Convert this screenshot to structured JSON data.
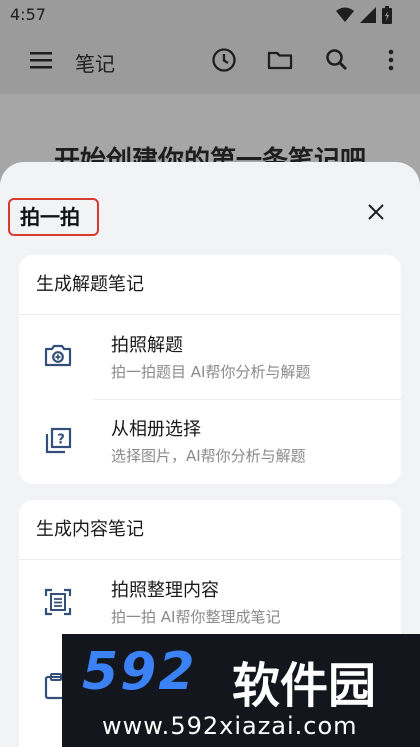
{
  "status": {
    "time": "4:57"
  },
  "appbar": {
    "title": "笔记"
  },
  "background": {
    "heading": "开始创建你的第一条笔记吧"
  },
  "sheet": {
    "title": "拍一拍",
    "sections": [
      {
        "heading": "生成解题笔记",
        "items": [
          {
            "title": "拍照解题",
            "subtitle": "拍一拍题目 AI帮你分析与解题",
            "icon": "camera-icon"
          },
          {
            "title": "从相册选择",
            "subtitle": "选择图片，AI帮你分析与解题",
            "icon": "album-question-icon"
          }
        ]
      },
      {
        "heading": "生成内容笔记",
        "items": [
          {
            "title": "拍照整理内容",
            "subtitle": "拍一拍 AI帮你整理成笔记",
            "icon": "scan-document-icon"
          }
        ]
      }
    ]
  },
  "watermark": {
    "logo": "592",
    "name": "软件园",
    "url": "www.592xiazai.com"
  },
  "colors": {
    "highlight": "#d63b2e",
    "icon": "#34507a",
    "watermark_logo": "#3b82f6"
  }
}
